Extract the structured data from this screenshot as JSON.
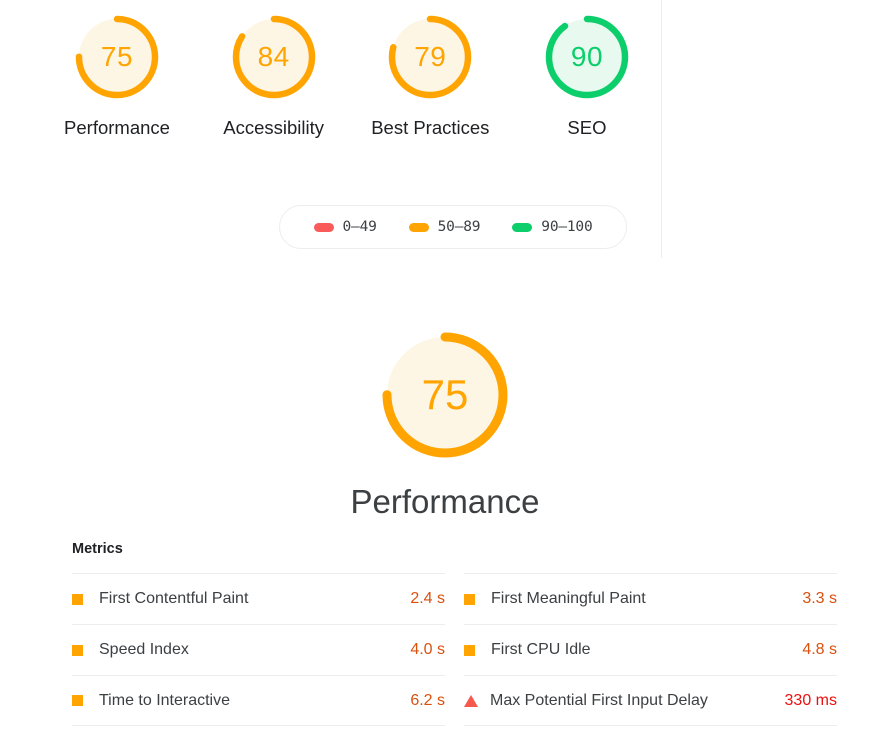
{
  "colors": {
    "fail": "#f95b5b",
    "average": "#ffa400",
    "pass": "#0cce6b",
    "average_bg": "#fef6e4",
    "pass_bg": "#e8faf0",
    "value_average": "#d9500f",
    "value_fail": "#eb0f0f"
  },
  "scores": {
    "items": [
      {
        "value": "75",
        "score": 75,
        "label": "Performance",
        "rating": "average"
      },
      {
        "value": "84",
        "score": 84,
        "label": "Accessibility",
        "rating": "average"
      },
      {
        "value": "79",
        "score": 79,
        "label": "Best Practices",
        "rating": "average"
      },
      {
        "value": "90",
        "score": 90,
        "label": "SEO",
        "rating": "pass"
      }
    ]
  },
  "legend": {
    "items": [
      {
        "label": "0–49",
        "rating": "fail"
      },
      {
        "label": "50–89",
        "rating": "average"
      },
      {
        "label": "90–100",
        "rating": "pass"
      }
    ]
  },
  "category": {
    "value": "75",
    "score": 75,
    "title": "Performance",
    "rating": "average"
  },
  "metrics": {
    "heading": "Metrics",
    "columns": [
      {
        "rows": [
          {
            "icon": "square-average-icon",
            "name": "First Contentful Paint",
            "value": "2.4 s",
            "rating": "average"
          },
          {
            "icon": "square-average-icon",
            "name": "Speed Index",
            "value": "4.0 s",
            "rating": "average"
          },
          {
            "icon": "square-average-icon",
            "name": "Time to Interactive",
            "value": "6.2 s",
            "rating": "average"
          }
        ]
      },
      {
        "rows": [
          {
            "icon": "square-average-icon",
            "name": "First Meaningful Paint",
            "value": "3.3 s",
            "rating": "average"
          },
          {
            "icon": "square-average-icon",
            "name": "First CPU Idle",
            "value": "4.8 s",
            "rating": "average"
          },
          {
            "icon": "triangle-fail-icon",
            "name": "Max Potential First Input Delay",
            "value": "330 ms",
            "rating": "fail"
          }
        ]
      }
    ]
  }
}
